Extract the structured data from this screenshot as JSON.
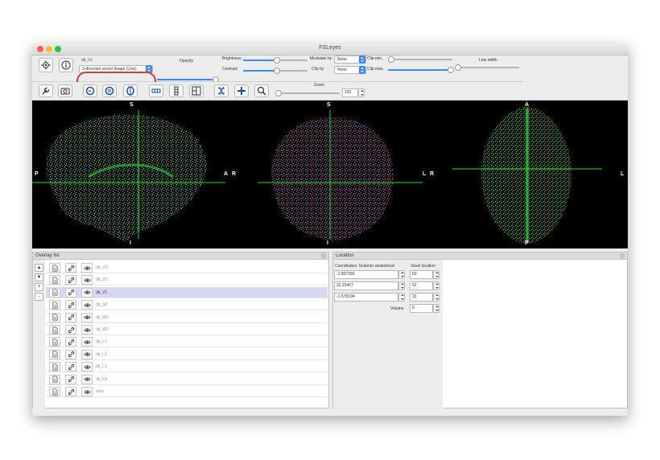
{
  "window": {
    "title": "FSLeyes"
  },
  "toolbar1": {
    "overlay_name": "dti_V1",
    "overlay_type": "3-direction vector image (Line)",
    "opacity_label": "Opacity",
    "brightness_label": "Brightness",
    "contrast_label": "Contrast",
    "modulate_label": "Modulate by",
    "modulate_value": "None",
    "clipby_label": "Clip by",
    "clipby_value": "None",
    "clipmin_label": "Clip min.",
    "clipmax_label": "Clip max.",
    "linewidth_label": "Line width"
  },
  "toolbar2": {
    "zoom_label": "Zoom",
    "zoom_value": "100"
  },
  "views": {
    "sagittal": {
      "top": "S",
      "bottom": "I",
      "left": "P",
      "right": "A"
    },
    "coronal": {
      "top": "S",
      "bottom": "I",
      "left": "R",
      "right": "L"
    },
    "axial": {
      "top": "A",
      "bottom": "P",
      "left": "R",
      "right": "L"
    }
  },
  "overlay_list": {
    "title": "Overlay list",
    "side_buttons": [
      "▲",
      "▼",
      "+",
      "-"
    ],
    "items": [
      {
        "name": "dti_V3",
        "selected": false
      },
      {
        "name": "dti_V2",
        "selected": false
      },
      {
        "name": "dti_V1",
        "selected": true
      },
      {
        "name": "dti_S0",
        "selected": false
      },
      {
        "name": "dti_MO",
        "selected": false
      },
      {
        "name": "dti_MD",
        "selected": false
      },
      {
        "name": "dti_L3",
        "selected": false
      },
      {
        "name": "dti_L2",
        "selected": false
      },
      {
        "name": "dti_L1",
        "selected": false
      },
      {
        "name": "dti_FA",
        "selected": false
      },
      {
        "name": "data",
        "selected": false
      }
    ]
  },
  "location": {
    "title": "Location",
    "coords_header": "Coordinates: Scanner anatomical",
    "voxel_header": "Voxel location",
    "coords": [
      "-2.857393",
      "22.23467",
      "-1.578194"
    ],
    "voxels": [
      "60",
      "62",
      "33"
    ],
    "volume_label": "Volume",
    "volume_value": "0"
  },
  "colors": {
    "accent": "#3b8bf0",
    "crosshair": "#22e022",
    "annotation": "#d43a3a",
    "selected_row": "#d8d8f6"
  }
}
